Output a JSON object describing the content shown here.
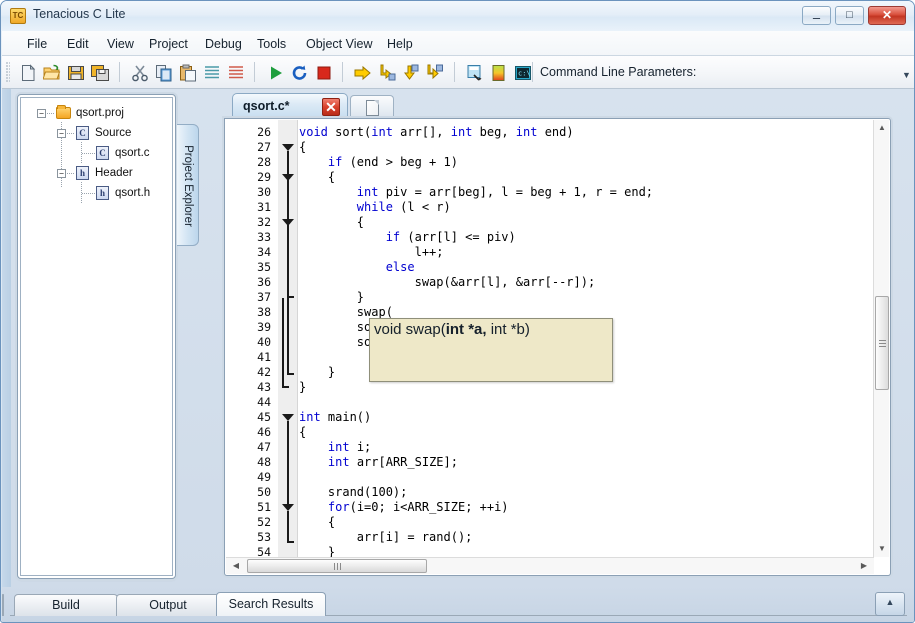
{
  "window": {
    "title": "Tenacious C Lite",
    "icon": "TC",
    "controls": {
      "minimize": "–",
      "maximize": "□",
      "close": "✕"
    }
  },
  "menubar": {
    "items": [
      {
        "label": "File"
      },
      {
        "label": "Edit"
      },
      {
        "label": "View"
      },
      {
        "label": "Project"
      },
      {
        "label": "Debug"
      },
      {
        "label": "Tools"
      },
      {
        "label": "Object View"
      },
      {
        "label": "Help"
      }
    ]
  },
  "toolbar": {
    "command_line_label": "Command Line Parameters:",
    "overflow_glyph": "▼",
    "buttons": [
      {
        "name": "new-file-icon"
      },
      {
        "name": "open-file-icon"
      },
      {
        "name": "save-icon"
      },
      {
        "name": "save-all-icon"
      },
      {
        "name": "cut-icon"
      },
      {
        "name": "copy-icon"
      },
      {
        "name": "paste-icon"
      },
      {
        "name": "indent-icon"
      },
      {
        "name": "comment-icon"
      },
      {
        "name": "run-icon"
      },
      {
        "name": "restart-icon"
      },
      {
        "name": "stop-icon"
      },
      {
        "name": "step-over-icon"
      },
      {
        "name": "step-into-icon"
      },
      {
        "name": "step-out-icon"
      },
      {
        "name": "run-to-cursor-icon"
      },
      {
        "name": "watch-window-icon"
      },
      {
        "name": "memory-view-icon"
      },
      {
        "name": "console-icon"
      }
    ]
  },
  "project_explorer": {
    "tab_label": "Project Explorer",
    "tree": [
      {
        "label": "qsort.proj",
        "icon": "folder-icon",
        "depth": 0,
        "expander": "−"
      },
      {
        "label": "Source",
        "icon": "c-file-icon",
        "depth": 1,
        "expander": "−",
        "badge": "C"
      },
      {
        "label": "qsort.c",
        "icon": "c-file-icon",
        "depth": 2,
        "expander": "",
        "badge": "C"
      },
      {
        "label": "Header",
        "icon": "h-file-icon",
        "depth": 1,
        "expander": "−",
        "badge": "h"
      },
      {
        "label": "qsort.h",
        "icon": "h-file-icon",
        "depth": 2,
        "expander": "",
        "badge": "h"
      }
    ]
  },
  "editor": {
    "tabs": [
      {
        "label": "qsort.c*",
        "active": true,
        "close_glyph": "✕"
      }
    ],
    "new_tab_name": "new-document-tab",
    "first_line_number": 26,
    "highlighted_line": 38,
    "lines": [
      {
        "n": 26,
        "text": "void sort(int arr[], int beg, int end)"
      },
      {
        "n": 27,
        "text": "{"
      },
      {
        "n": 28,
        "text": "    if (end > beg + 1)"
      },
      {
        "n": 29,
        "text": "    {"
      },
      {
        "n": 30,
        "text": "        int piv = arr[beg], l = beg + 1, r = end;"
      },
      {
        "n": 31,
        "text": "        while (l < r)"
      },
      {
        "n": 32,
        "text": "        {"
      },
      {
        "n": 33,
        "text": "            if (arr[l] <= piv)"
      },
      {
        "n": 34,
        "text": "                l++;"
      },
      {
        "n": 35,
        "text": "            else"
      },
      {
        "n": 36,
        "text": "                swap(&arr[l], &arr[--r]);"
      },
      {
        "n": 37,
        "text": "        }"
      },
      {
        "n": 38,
        "text": "        swap("
      },
      {
        "n": 39,
        "text": "        sort(arr, beg, r);"
      },
      {
        "n": 40,
        "text": "        sort(arr, r, end);"
      },
      {
        "n": 41,
        "text": ""
      },
      {
        "n": 42,
        "text": "    }"
      },
      {
        "n": 43,
        "text": "}"
      },
      {
        "n": 44,
        "text": ""
      },
      {
        "n": 45,
        "text": "int main()"
      },
      {
        "n": 46,
        "text": "{"
      },
      {
        "n": 47,
        "text": "    int i;"
      },
      {
        "n": 48,
        "text": "    int arr[ARR_SIZE];"
      },
      {
        "n": 49,
        "text": ""
      },
      {
        "n": 50,
        "text": "    srand(100);"
      },
      {
        "n": 51,
        "text": "    for(i=0; i<ARR_SIZE; ++i)"
      },
      {
        "n": 52,
        "text": "    {"
      },
      {
        "n": 53,
        "text": "        arr[i] = rand();"
      },
      {
        "n": 54,
        "text": "    }"
      }
    ],
    "keywords": [
      "void",
      "int",
      "if",
      "while",
      "else",
      "for"
    ],
    "tooltip": {
      "prefix": "void swap(",
      "bold": "int *a,",
      "suffix": " int *b)"
    },
    "scrollbars": {
      "v_up": "▲",
      "v_down": "▼",
      "h_left": "◀",
      "h_right": "▶"
    }
  },
  "bottom_tabs": {
    "items": [
      {
        "label": "Build",
        "active": false
      },
      {
        "label": "Output",
        "active": false
      },
      {
        "label": "Search Results",
        "active": true
      }
    ],
    "expand_glyph": "▲"
  },
  "colors": {
    "keyword": "#0000d0",
    "tooltip_bg": "#eee8c8",
    "highlight_line": "#e8e8d8",
    "titlebar_text": "#24384d",
    "close_button": "#c33522"
  }
}
